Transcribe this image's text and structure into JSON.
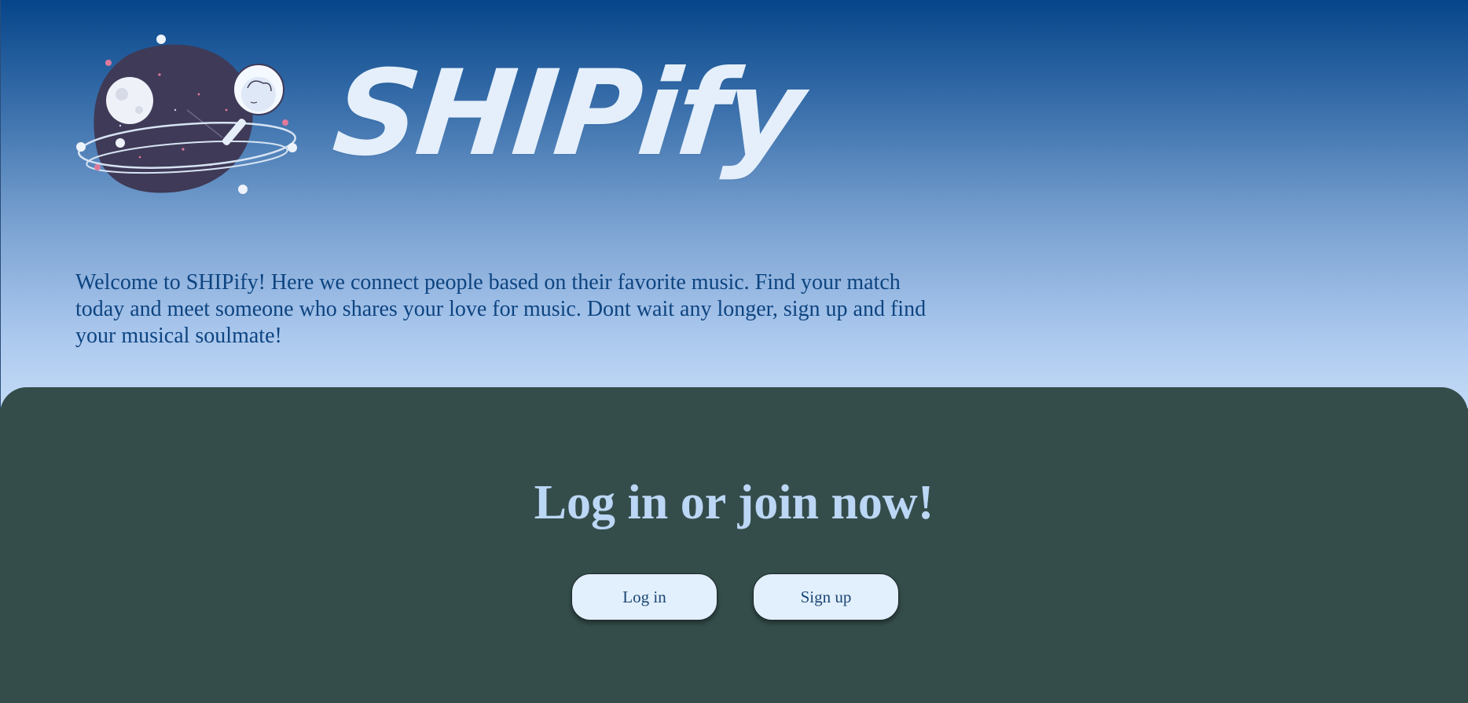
{
  "brand": {
    "title": "SHIPify"
  },
  "hero": {
    "intro_text": "Welcome to SHIPify! Here we connect people based on their favorite music. Find your match today and meet someone who shares your love for music. Dont wait any longer, sign up and find your musical soulmate!"
  },
  "cta": {
    "heading": "Log in or join now!",
    "login_label": "Log in",
    "signup_label": "Sign up"
  },
  "icons": {
    "logo": "planet-astronaut-icon"
  },
  "colors": {
    "hero_top": "#06458a",
    "hero_bottom": "#c4dbf7",
    "panel_bg": "#344d4b",
    "heading_color": "#bcd6f5",
    "button_bg": "#e2effc",
    "intro_text_color": "#0d4480"
  }
}
